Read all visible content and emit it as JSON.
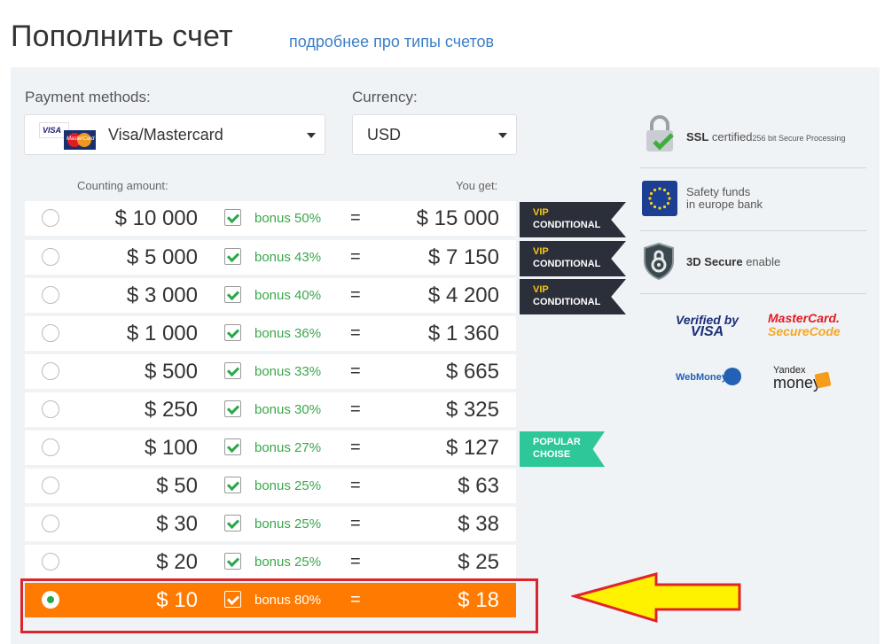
{
  "header": {
    "title": "Пополнить счет",
    "link": "подробнее про типы счетов"
  },
  "form": {
    "payment_label": "Payment methods:",
    "payment_value": "Visa/Mastercard",
    "payment_icon": "visa-mastercard-logo",
    "visa_text": "VISA",
    "mc_text": "MasterCard",
    "currency_label": "Currency:",
    "currency_value": "USD"
  },
  "table": {
    "col_amount": "Counting amount:",
    "col_get": "You get:",
    "rows": [
      {
        "amount": "$ 10 000",
        "bonus": "bonus 50%",
        "eq": "=",
        "get": "$ 15 000",
        "checked": true,
        "selected": false
      },
      {
        "amount": "$ 5 000",
        "bonus": "bonus 43%",
        "eq": "=",
        "get": "$ 7 150",
        "checked": true,
        "selected": false
      },
      {
        "amount": "$ 3 000",
        "bonus": "bonus 40%",
        "eq": "=",
        "get": "$ 4 200",
        "checked": true,
        "selected": false
      },
      {
        "amount": "$ 1 000",
        "bonus": "bonus 36%",
        "eq": "=",
        "get": "$ 1 360",
        "checked": true,
        "selected": false
      },
      {
        "amount": "$ 500",
        "bonus": "bonus 33%",
        "eq": "=",
        "get": "$ 665",
        "checked": true,
        "selected": false
      },
      {
        "amount": "$ 250",
        "bonus": "bonus 30%",
        "eq": "=",
        "get": "$ 325",
        "checked": true,
        "selected": false
      },
      {
        "amount": "$ 100",
        "bonus": "bonus 27%",
        "eq": "=",
        "get": "$ 127",
        "checked": true,
        "selected": false
      },
      {
        "amount": "$ 50",
        "bonus": "bonus 25%",
        "eq": "=",
        "get": "$ 63",
        "checked": true,
        "selected": false
      },
      {
        "amount": "$ 30",
        "bonus": "bonus 25%",
        "eq": "=",
        "get": "$ 38",
        "checked": true,
        "selected": false
      },
      {
        "amount": "$ 20",
        "bonus": "bonus 25%",
        "eq": "=",
        "get": "$ 25",
        "checked": true,
        "selected": false
      },
      {
        "amount": "$ 10",
        "bonus": "bonus 80%",
        "eq": "=",
        "get": "$ 18",
        "checked": true,
        "selected": true
      }
    ]
  },
  "ribbons": {
    "vip_line1": "VIP",
    "vip_line2": "CONDITIONAL",
    "popular_line1": "POPULAR",
    "popular_line2": "CHOISE"
  },
  "security": {
    "ssl_bold": "SSL",
    "ssl_text": " certified",
    "ssl_small": "256 bit Secure Processing",
    "safety_line1": "Safety funds",
    "safety_line2": "in europe bank",
    "secure3d_bold": "3D Secure",
    "secure3d_text": " enable"
  },
  "logos": {
    "vbv_line1": "Verified by",
    "vbv_line2": "VISA",
    "mc_line1": "MasterCard.",
    "mc_line2": "SecureCode",
    "webmoney": "WebMoney",
    "yandex_line1": "Yandex",
    "yandex_line2": "money"
  },
  "colors": {
    "selected_row": "#ff7a00",
    "bonus_green": "#3aa74a",
    "vip_ribbon": "#2b2f3a",
    "vip_text": "#f5c518",
    "popular_ribbon": "#2ec79a",
    "annotation_red": "#d9262e",
    "annotation_arrow": "#fff200"
  }
}
